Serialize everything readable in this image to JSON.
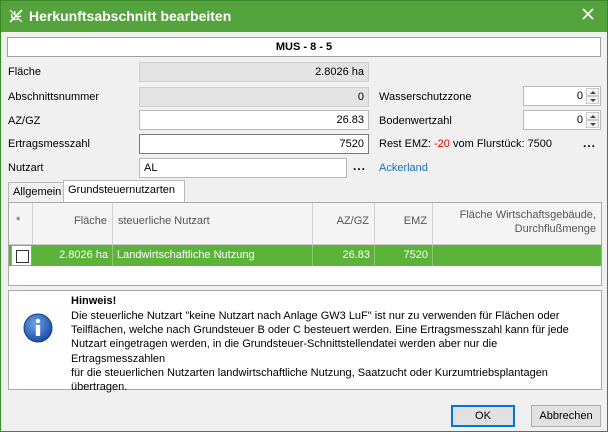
{
  "window": {
    "title": "Herkunftsabschnitt bearbeiten",
    "accent": "#55a33c"
  },
  "heading": "MUS - 8 - 5",
  "form": {
    "flaeche_label": "Fläche",
    "flaeche_value": "2.8026 ha",
    "abschnittsnummer_label": "Abschnittsnummer",
    "abschnittsnummer_value": "0",
    "azgz_label": "AZ/GZ",
    "azgz_value": "26.83",
    "ertragsmesszahl_label": "Ertragsmesszahl",
    "ertragsmesszahl_value": "7520",
    "nutzart_label": "Nutzart",
    "nutzart_value": "AL",
    "nutzart_ellipsis": "...",
    "nutzart_link": "Ackerland",
    "wasserschutzzone_label": "Wasserschutzzone",
    "wasserschutzzone_value": "0",
    "bodenwertzahl_label": "Bodenwertzahl",
    "bodenwertzahl_value": "0",
    "rest_emz_label": "Rest EMZ:",
    "rest_emz_value": "-20",
    "flurstueck_label": "vom Flurstück:",
    "flurstueck_value": "7500",
    "rest_ellipsis": "..."
  },
  "tabs": [
    {
      "label": "Allgemein"
    },
    {
      "label": "Grundsteuernutzarten"
    }
  ],
  "grid": {
    "columns": [
      "*",
      "Fläche",
      "steuerliche Nutzart",
      "AZ/GZ",
      "EMZ",
      "Fläche Wirtschaftsgebäude,",
      "Durchflußmenge"
    ],
    "row": {
      "flaeche": "2.8026 ha",
      "nutzart": "Landwirtschaftliche Nutzung",
      "azgz": "26.83",
      "emz": "7520",
      "wirtschaft": ""
    },
    "row_color": "#5cb33a"
  },
  "hint": {
    "title": "Hinweis!",
    "lines": [
      "Die steuerliche Nutzart \"keine Nutzart nach Anlage GW3 LuF\" ist nur zu verwenden für Flächen oder",
      "Teilflächen, welche nach Grundsteuer B oder C besteuert werden. Eine Ertragsmesszahl kann für jede",
      "Nutzart eingetragen werden, in die Grundsteuer-Schnittstellendatei werden aber nur die Ertragsmesszahlen",
      "für die steuerlichen Nutzarten landwirtschaftliche Nutzung, Saatzucht oder Kurzumtriebsplantagen",
      "übertragen."
    ],
    "icon": "info-icon"
  },
  "buttons": {
    "ok": "OK",
    "cancel": "Abbrechen"
  }
}
